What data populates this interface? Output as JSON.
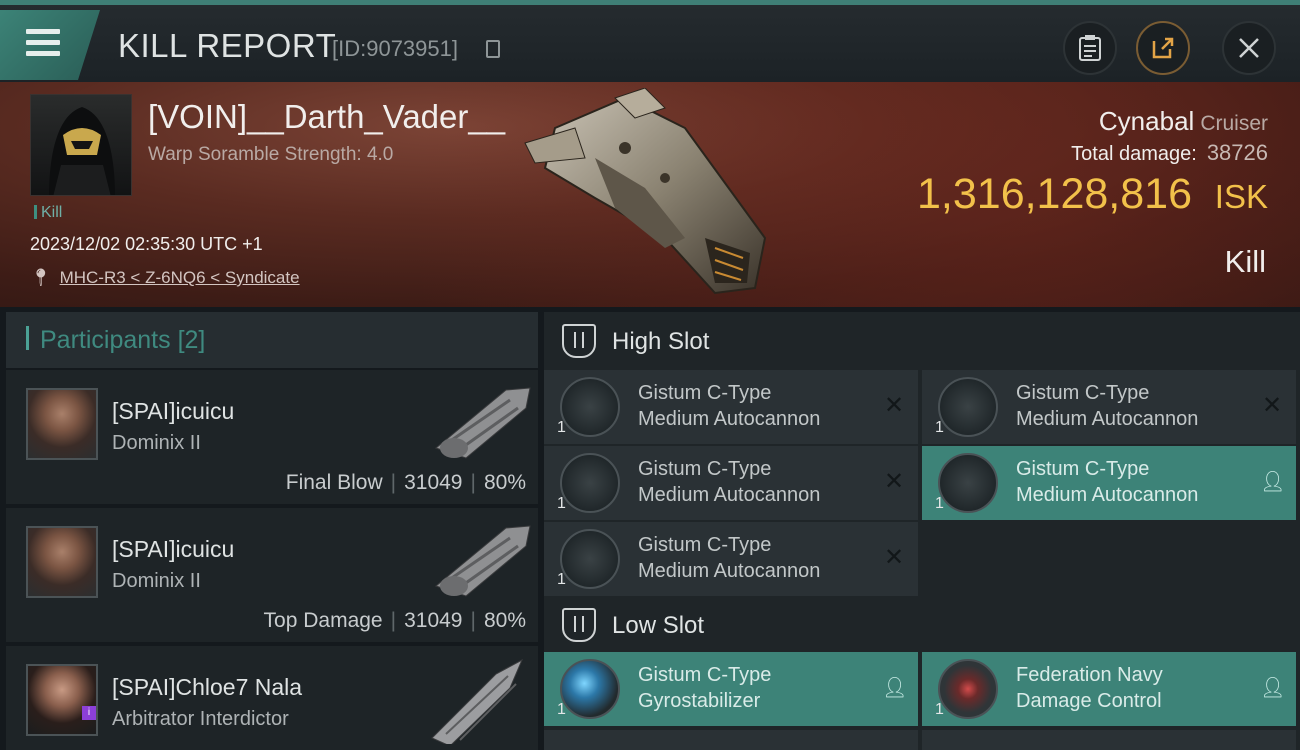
{
  "header": {
    "title": "KILL REPORT",
    "report_id": "[ID:9073951]"
  },
  "victim": {
    "name": "[VOIN]__Darth_Vader__",
    "scramble": "Warp Soramble Strength: 4.0",
    "tag": "Kill",
    "datetime": "2023/12/02 02:35:30 UTC +1",
    "location": "MHC-R3 < Z-6NQ6 < Syndicate",
    "ship_name": "Cynabal",
    "ship_class": "Cruiser",
    "total_damage_label": "Total damage:",
    "total_damage": "38726",
    "isk_value": "1,316,128,816",
    "isk_unit": "ISK",
    "result": "Kill"
  },
  "participants": {
    "label": "Participants",
    "count": "[2]",
    "items": [
      {
        "name": "[SPAI]icuicu",
        "ship": "Dominix II",
        "role": "Final Blow",
        "damage": "31049",
        "percent": "80%"
      },
      {
        "name": "[SPAI]icuicu",
        "ship": "Dominix II",
        "role": "Top Damage",
        "damage": "31049",
        "percent": "80%"
      },
      {
        "name": "[SPAI]Chloe7 Nala",
        "ship": "Arbitrator Interdictor",
        "badge": "i"
      }
    ]
  },
  "slots": {
    "high": {
      "label": "High Slot",
      "modules": [
        {
          "line1": "Gistum C-Type",
          "line2": "Medium Autocannon",
          "qty": "1",
          "state": "destroyed"
        },
        {
          "line1": "Gistum C-Type",
          "line2": "Medium Autocannon",
          "qty": "1",
          "state": "destroyed"
        },
        {
          "line1": "Gistum C-Type",
          "line2": "Medium Autocannon",
          "qty": "1",
          "state": "destroyed"
        },
        {
          "line1": "Gistum C-Type",
          "line2": "Medium Autocannon",
          "qty": "1",
          "state": "dropped"
        },
        {
          "line1": "Gistum C-Type",
          "line2": "Medium Autocannon",
          "qty": "1",
          "state": "destroyed"
        }
      ]
    },
    "low": {
      "label": "Low Slot",
      "modules": [
        {
          "line1": "Gistum C-Type",
          "line2": "Gyrostabilizer",
          "qty": "1",
          "state": "dropped"
        },
        {
          "line1": "Federation Navy",
          "line2": "Damage Control",
          "qty": "1",
          "state": "dropped"
        }
      ]
    }
  },
  "icons": {
    "destroyed": "x-icon",
    "dropped": "person-icon"
  },
  "colors": {
    "accent": "#3d8378",
    "isk": "#f2c14a",
    "banner": "#5a2b21"
  }
}
